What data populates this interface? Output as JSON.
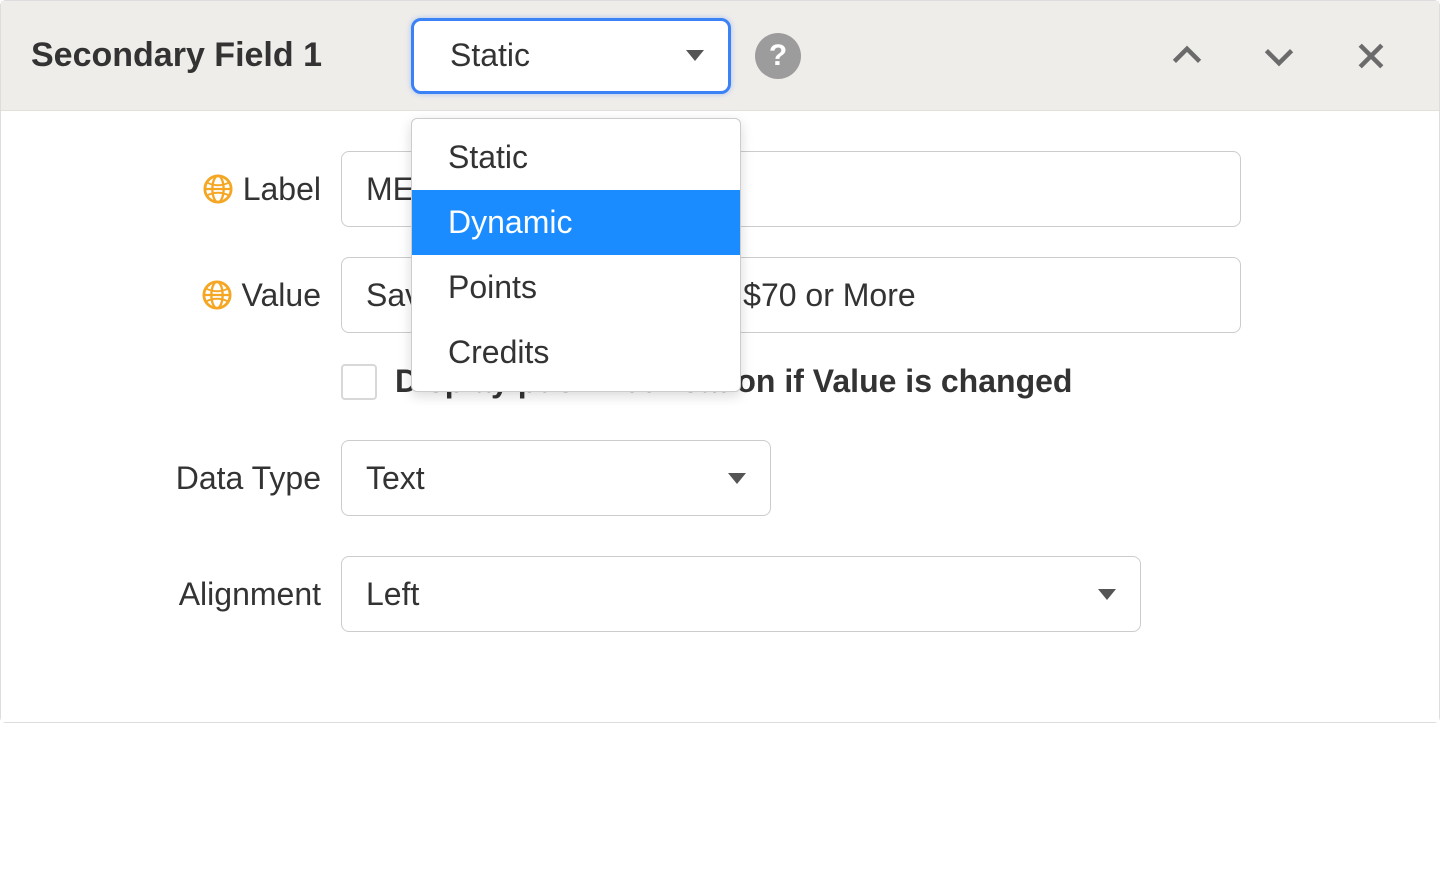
{
  "header": {
    "title": "Secondary Field 1",
    "selected": "Static",
    "options": [
      "Static",
      "Dynamic",
      "Points",
      "Credits"
    ],
    "highlighted_option": "Dynamic"
  },
  "icons": {
    "help": "?",
    "move_up": "chevron-up",
    "move_down": "chevron-down",
    "remove": "x",
    "globe": "globe"
  },
  "fields": {
    "label_label": "Label",
    "label_value": "MEMBER REWARDS",
    "value_label": "Value",
    "value_value": "Save $7 on a Purchase of $70 or More",
    "notification_label": "Display push notification if Value is changed",
    "datatype_label": "Data Type",
    "datatype_value": "Text",
    "alignment_label": "Alignment",
    "alignment_value": "Left"
  }
}
